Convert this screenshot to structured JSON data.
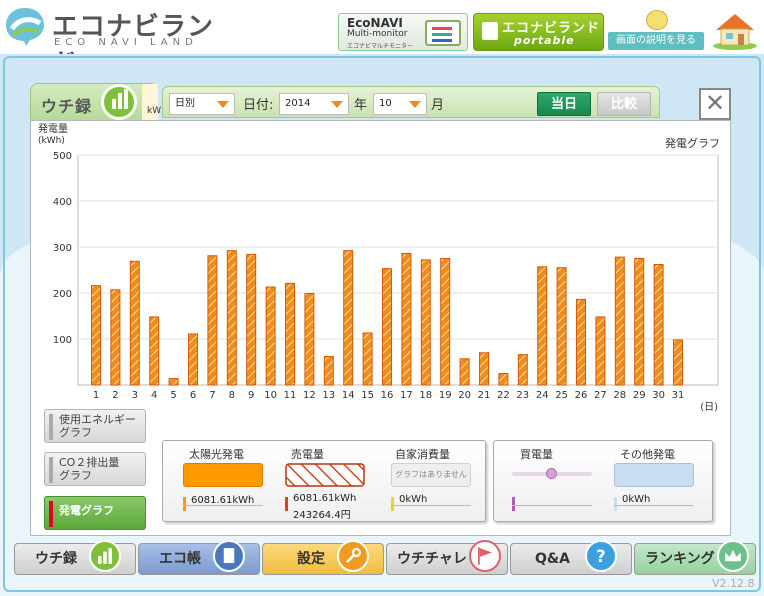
{
  "header": {
    "logo_text": "エコナビランド",
    "logo_sub": "ECO NAVI LAND",
    "econavi": {
      "line1": "EcoNAVI",
      "line2": "Multi-monitor",
      "line3": "エコナビマルチモニター"
    },
    "portable": {
      "line1": "エコナビランド",
      "line2": "portable"
    },
    "help_label": "画面の説明を見る"
  },
  "panel": {
    "tab_label": "ウチ録",
    "tab_sub_unit": "kW",
    "close_symbol": "✕"
  },
  "filter": {
    "period_value": "日別",
    "date_label": "日付:",
    "year_value": "2014",
    "year_label": "年",
    "month_value": "10",
    "month_label": "月",
    "today_label": "当日",
    "compare_label": "比較"
  },
  "chart_data": {
    "type": "bar",
    "title": "発電グラフ",
    "ylabel": "発電量",
    "yunit": "(kWh)",
    "xunit": "(日)",
    "ylim": [
      0,
      500
    ],
    "yticks": [
      100,
      200,
      300,
      400,
      500
    ],
    "categories": [
      "1",
      "2",
      "3",
      "4",
      "5",
      "6",
      "7",
      "8",
      "9",
      "10",
      "11",
      "12",
      "13",
      "14",
      "15",
      "16",
      "17",
      "18",
      "19",
      "20",
      "21",
      "22",
      "23",
      "24",
      "25",
      "26",
      "27",
      "28",
      "29",
      "30",
      "31"
    ],
    "values": [
      216,
      207,
      269,
      148,
      14,
      111,
      281,
      292,
      284,
      213,
      221,
      199,
      62,
      292,
      113,
      253,
      286,
      272,
      275,
      57,
      70,
      25,
      66,
      257,
      255,
      186,
      148,
      278,
      275,
      262,
      98
    ],
    "bar_color": "#f08c1a",
    "bar_stroke": "#d45a0a",
    "grid": true
  },
  "side_buttons": [
    {
      "line1": "使用エネルギー",
      "line2": "グラフ",
      "active": false
    },
    {
      "line1": "CO２排出量",
      "line2": "グラフ",
      "active": false
    },
    {
      "line1": "発電グラフ",
      "line2": "",
      "active": true
    }
  ],
  "summary": {
    "solar": {
      "label": "太陽光発電",
      "value": "6081.61kWh",
      "color": "#ff9900"
    },
    "sell": {
      "label": "売電量",
      "value": "6081.61kWh",
      "value2": "243264.4円",
      "color": "#d9441e"
    },
    "self": {
      "label": "自家消費量",
      "note": "グラフはありません",
      "value": "0kWh",
      "color": "#e8d81a"
    },
    "buy": {
      "label": "買電量",
      "value": "",
      "color": "#b060b0"
    },
    "other": {
      "label": "その他発電",
      "value": "0kWh",
      "color": "#c8dcf2"
    }
  },
  "nav": [
    {
      "label": "ウチ録",
      "color": "#d8d8d8",
      "icon_color": "#7fbf3a",
      "icon": "bar-chart-icon"
    },
    {
      "label": "エコ帳",
      "color": "#8aa8d8",
      "icon_color": "#4a78c0",
      "icon": "notebook-icon"
    },
    {
      "label": "設定",
      "color": "#f6c75a",
      "icon_color": "#f09a20",
      "icon": "wrench-icon"
    },
    {
      "label": "ウチチャレ",
      "color": "#d8d8d8",
      "icon_color": "#e0606a",
      "icon": "flag-icon"
    },
    {
      "label": "Q&A",
      "color": "#d8d8d8",
      "icon_color": "#3aa0e0",
      "icon": "question-icon"
    },
    {
      "label": "ランキング",
      "color": "#a8d8b0",
      "icon_color": "#6cc08a",
      "icon": "crown-icon"
    }
  ],
  "version": "V2.12.8"
}
